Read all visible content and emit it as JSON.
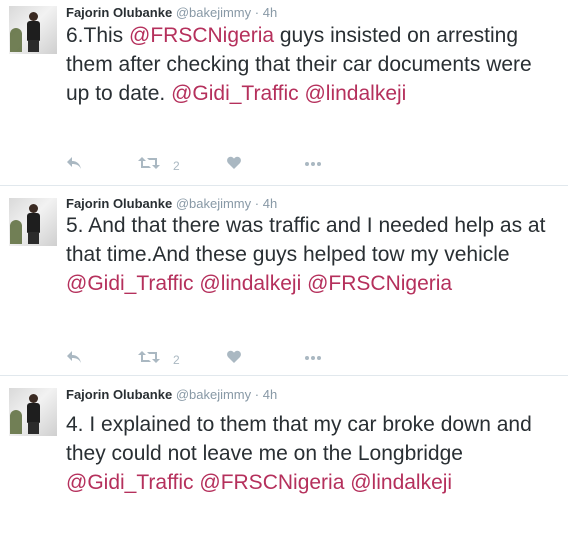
{
  "tweets": [
    {
      "author": "Fajorin Olubanke",
      "handle": "@bakejimmy",
      "separator": "·",
      "time": "4h",
      "segments": [
        {
          "t": "6.This ",
          "m": false
        },
        {
          "t": "@FRSCNigeria",
          "m": true
        },
        {
          "t": " guys insisted on arresting them after checking that their car documents were up to date. ",
          "m": false
        },
        {
          "t": "@Gidi_Traffic",
          "m": true
        },
        {
          "t": " ",
          "m": false
        },
        {
          "t": "@lindalkeji",
          "m": true
        }
      ],
      "retweet_count": "2"
    },
    {
      "author": "Fajorin Olubanke",
      "handle": "@bakejimmy",
      "separator": "·",
      "time": "4h",
      "segments": [
        {
          "t": "5. And that there was traffic and I needed help as at that time.And these guys helped tow my vehicle ",
          "m": false
        },
        {
          "t": "@Gidi_Traffic",
          "m": true
        },
        {
          "t": " ",
          "m": false
        },
        {
          "t": "@lindalkeji",
          "m": true
        },
        {
          "t": " ",
          "m": false
        },
        {
          "t": "@FRSCNigeria",
          "m": true
        }
      ],
      "retweet_count": "2"
    },
    {
      "author": "Fajorin Olubanke",
      "handle": "@bakejimmy",
      "separator": "·",
      "time": "4h",
      "segments": [
        {
          "t": "4. I explained to them that my car broke down and they could not leave me on the Longbridge ",
          "m": false
        },
        {
          "t": "@Gidi_Traffic",
          "m": true
        },
        {
          "t": " ",
          "m": false
        },
        {
          "t": "@FRSCNigeria",
          "m": true
        },
        {
          "t": " ",
          "m": false
        },
        {
          "t": "@lindalkeji",
          "m": true
        }
      ],
      "retweet_count": ""
    }
  ],
  "colors": {
    "mention": "#b5305c",
    "text": "#292f33",
    "meta": "#8899a6",
    "action_icons": "#aab8c2"
  },
  "icons": [
    "reply-icon",
    "retweet-icon",
    "heart-icon",
    "more-dots-icon"
  ]
}
